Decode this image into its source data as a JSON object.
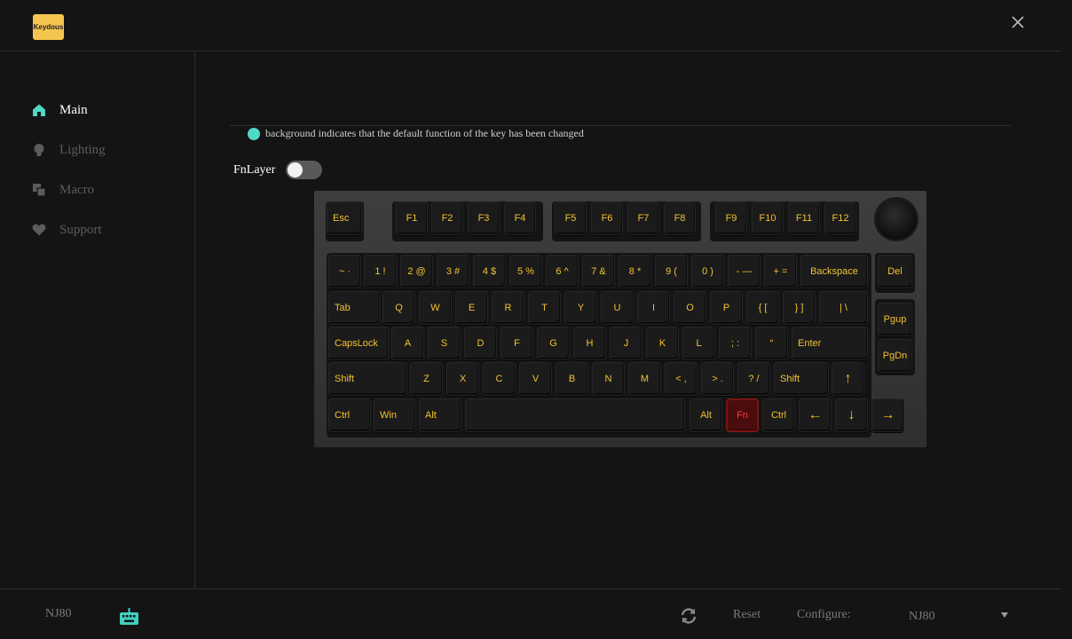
{
  "header": {
    "logo_text": "Keydous",
    "close_icon": "close-icon"
  },
  "sidebar": {
    "items": [
      {
        "label": "Main",
        "icon": "home-icon",
        "active": true
      },
      {
        "label": "Lighting",
        "icon": "bulb-icon",
        "active": false
      },
      {
        "label": "Macro",
        "icon": "macro-icon",
        "active": false
      },
      {
        "label": "Support",
        "icon": "heart-icon",
        "active": false
      }
    ]
  },
  "main": {
    "legend_text": "background indicates that the default function of the key has been changed",
    "legend_color": "#4fd8c5",
    "fnlayer_label": "FnLayer",
    "fnlayer_on": false
  },
  "keyboard": {
    "keys": {
      "esc": "Esc",
      "f1": "F1",
      "f2": "F2",
      "f3": "F3",
      "f4": "F4",
      "f5": "F5",
      "f6": "F6",
      "f7": "F7",
      "f8": "F8",
      "f9": "F9",
      "f10": "F10",
      "f11": "F11",
      "f12": "F12",
      "grave": "~ ·",
      "1": "1 !",
      "2": "2 @",
      "3": "3 #",
      "4": "4 $",
      "5": "5 %",
      "6": "6 ^",
      "7": "7 &",
      "8": "8 *",
      "9": "9 (",
      "0": "0 )",
      "minus": "- —",
      "equal": "+ =",
      "backspace": "Backspace",
      "del": "Del",
      "tab": "Tab",
      "q": "Q",
      "w": "W",
      "e": "E",
      "r": "R",
      "t": "T",
      "y": "Y",
      "u": "U",
      "i": "I",
      "o": "O",
      "p": "P",
      "lbracket": "{ [",
      "rbracket": "} ]",
      "backslash": "| \\",
      "pgup": "Pgup",
      "capslock": "CapsLock",
      "a": "A",
      "s": "S",
      "d": "D",
      "f": "F",
      "g": "G",
      "h": "H",
      "j": "J",
      "k": "K",
      "l": "L",
      "semicolon": "; :",
      "quote": "“",
      "enter": "Enter",
      "pgdn": "PgDn",
      "lshift": "Shift",
      "z": "Z",
      "x": "X",
      "c": "C",
      "v": "V",
      "b": "B",
      "n": "N",
      "m": "M",
      "comma": "< ,",
      "period": "> .",
      "slash": "? /",
      "rshift": "Shift",
      "up": "↑",
      "lctrl": "Ctrl",
      "win": "Win",
      "lalt": "Alt",
      "space": "",
      "ralt": "Alt",
      "fn": "Fn",
      "rctrl": "Ctrl",
      "left": "←",
      "down": "↓",
      "right": "→"
    },
    "highlight_color": "#f2c230",
    "changed_key_color": "#ff3b3b"
  },
  "footer": {
    "device_name": "NJ80",
    "reset_label": "Reset",
    "configure_label": "Configure:",
    "configure_value": "NJ80"
  }
}
